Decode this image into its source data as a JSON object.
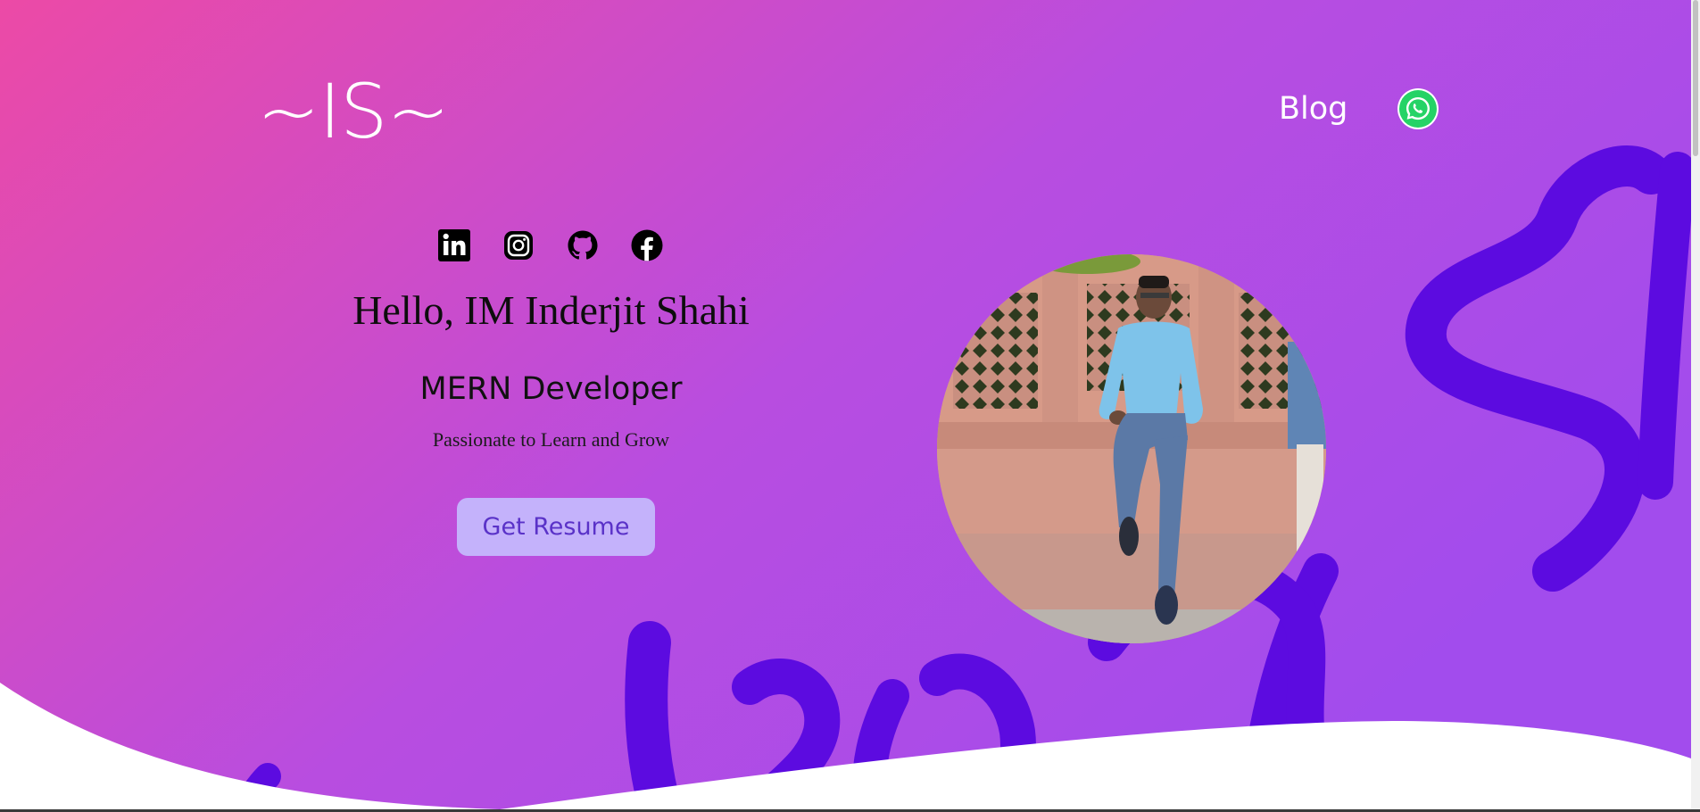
{
  "header": {
    "logo": "~IS~",
    "nav": {
      "blog": "Blog"
    },
    "whatsapp_icon": "whatsapp-icon"
  },
  "social": [
    {
      "icon": "linkedin-icon"
    },
    {
      "icon": "instagram-icon"
    },
    {
      "icon": "github-icon"
    },
    {
      "icon": "facebook-icon"
    }
  ],
  "hero": {
    "greeting": "Hello, IM Inderjit Shahi",
    "role": "MERN Developer",
    "tagline": "Passionate to Learn and Grow",
    "resume_button": "Get Resume"
  },
  "colors": {
    "gradient_start": "#ec4aa6",
    "gradient_end": "#a24ced",
    "script_purple": "#5c0be0",
    "resume_bg": "#c4b2fb",
    "resume_text": "#5a32c8",
    "whatsapp_green": "#25d366"
  }
}
